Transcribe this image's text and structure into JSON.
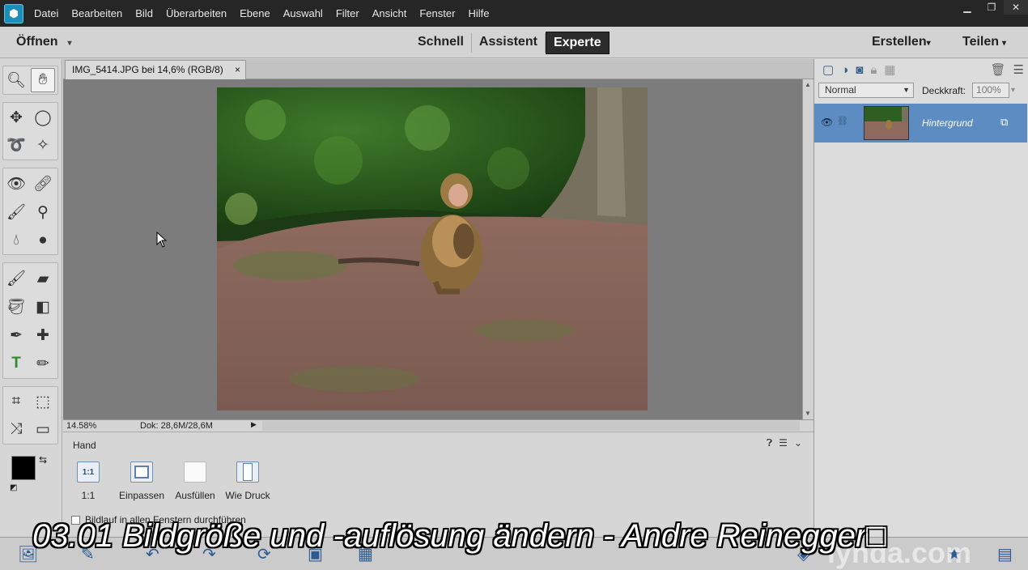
{
  "menu": {
    "items": [
      "Datei",
      "Bearbeiten",
      "Bild",
      "Überarbeiten",
      "Ebene",
      "Auswahl",
      "Filter",
      "Ansicht",
      "Fenster",
      "Hilfe"
    ]
  },
  "modebar": {
    "open_label": "Öffnen",
    "tabs": [
      "Schnell",
      "Assistent",
      "Experte"
    ],
    "active_tab": "Experte",
    "create_label": "Erstellen",
    "share_label": "Teilen"
  },
  "document": {
    "tab_title": "IMG_5414.JPG bei 14,6% (RGB/8)",
    "close_glyph": "×",
    "zoom": "14.58%",
    "info": "Dok: 28,6M/28,6M"
  },
  "tool_options": {
    "tool_name": "Hand",
    "buttons": [
      {
        "icon_text": "1:1",
        "label": "1:1"
      },
      {
        "icon_text": "",
        "label": "Einpassen"
      },
      {
        "icon_text": "",
        "label": "Ausfüllen"
      },
      {
        "icon_text": "",
        "label": "Wie Druck"
      }
    ],
    "checkbox_label": "Bildlauf in allen Fenstern durchführen",
    "checkbox_checked": false
  },
  "layers": {
    "blend_mode": "Normal",
    "opacity_label": "Deckkraft:",
    "opacity_value": "100%",
    "layer_name": "Hintergrund"
  },
  "overlay": {
    "subtitle": "03.01 Bildgröße und -auflösung ändern - Andre Reinegger",
    "watermark": "lynda.com"
  },
  "colors": {
    "menu_bg": "#262626",
    "active_tab_bg": "#2c2c2c",
    "canvas_bg": "#7c7c7c",
    "layer_selected": "#5c8cc2",
    "foreground": "#000000",
    "background": "#ffffff"
  }
}
